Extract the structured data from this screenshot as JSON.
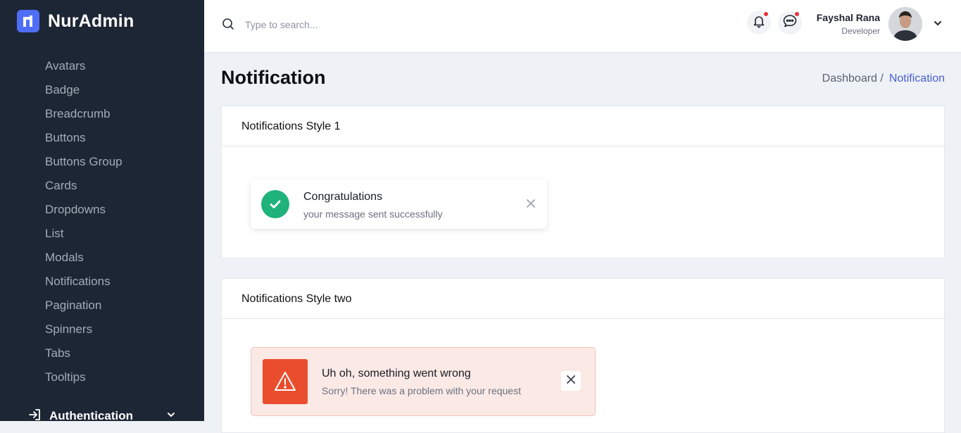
{
  "brand": {
    "name": "NurAdmin"
  },
  "sidebar": {
    "items": [
      {
        "label": "Avatars"
      },
      {
        "label": "Badge"
      },
      {
        "label": "Breadcrumb"
      },
      {
        "label": "Buttons"
      },
      {
        "label": "Buttons Group"
      },
      {
        "label": "Cards"
      },
      {
        "label": "Dropdowns"
      },
      {
        "label": "List"
      },
      {
        "label": "Modals"
      },
      {
        "label": "Notifications"
      },
      {
        "label": "Pagination"
      },
      {
        "label": "Spinners"
      },
      {
        "label": "Tabs"
      },
      {
        "label": "Tooltips"
      }
    ],
    "section": {
      "label": "Authentication"
    }
  },
  "header": {
    "search_placeholder": "Type to search...",
    "user": {
      "name": "Fayshal Rana",
      "role": "Developer"
    }
  },
  "page": {
    "title": "Notification",
    "breadcrumb": {
      "home": "Dashboard /",
      "current": "Notification"
    }
  },
  "card1": {
    "title": "Notifications Style 1",
    "toast": {
      "title": "Congratulations",
      "message": "your message sent successfully"
    }
  },
  "card2": {
    "title": "Notifications Style two",
    "toast": {
      "title": "Uh oh, something went wrong",
      "message": "Sorry! There was a problem with your request"
    }
  },
  "colors": {
    "sidebar_bg": "#1d2634",
    "brand_accent": "#4f6ef7",
    "success": "#1fb27a",
    "danger": "#ea4d2d",
    "danger_bg": "#fbe9e6",
    "link": "#4b5bd0",
    "notification_dot": "#e5343d"
  },
  "icons": [
    "brand-logo-icon",
    "search-icon",
    "bell-icon",
    "chat-icon",
    "chevron-down-icon",
    "check-icon",
    "close-icon",
    "warning-icon",
    "login-icon"
  ]
}
